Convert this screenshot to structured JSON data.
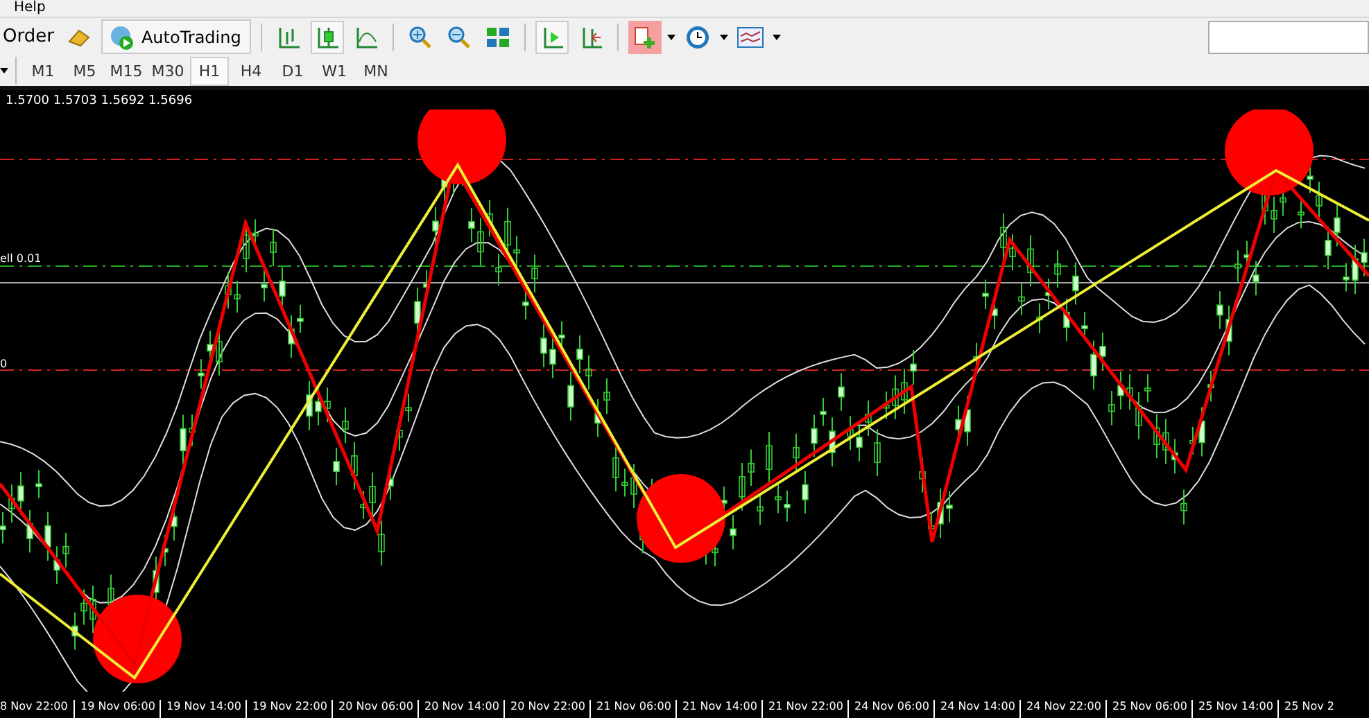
{
  "menu": [
    "Help"
  ],
  "toolbar": {
    "order_label": "Order",
    "autotrading_label": "AutoTrading"
  },
  "timeframes": [
    {
      "label": "M1",
      "selected": false
    },
    {
      "label": "M5",
      "selected": false
    },
    {
      "label": "M15",
      "selected": false
    },
    {
      "label": "M30",
      "selected": false
    },
    {
      "label": "H1",
      "selected": true
    },
    {
      "label": "H4",
      "selected": false
    },
    {
      "label": "D1",
      "selected": false
    },
    {
      "label": "W1",
      "selected": false
    },
    {
      "label": "MN",
      "selected": false
    }
  ],
  "chart": {
    "ohlc": "1.5700 1.5703 1.5692 1.5696",
    "level_labels": [
      {
        "text": "ell 0.01",
        "kind": "trade"
      },
      {
        "text": "0",
        "kind": "stop"
      }
    ],
    "time_labels": [
      "8 Nov 22:00",
      "19 Nov 06:00",
      "19 Nov 14:00",
      "19 Nov 22:00",
      "20 Nov 06:00",
      "20 Nov 14:00",
      "20 Nov 22:00",
      "21 Nov 06:00",
      "21 Nov 14:00",
      "21 Nov 22:00",
      "24 Nov 06:00",
      "24 Nov 14:00",
      "24 Nov 22:00",
      "25 Nov 06:00",
      "25 Nov 14:00",
      "25 Nov 2"
    ]
  }
}
